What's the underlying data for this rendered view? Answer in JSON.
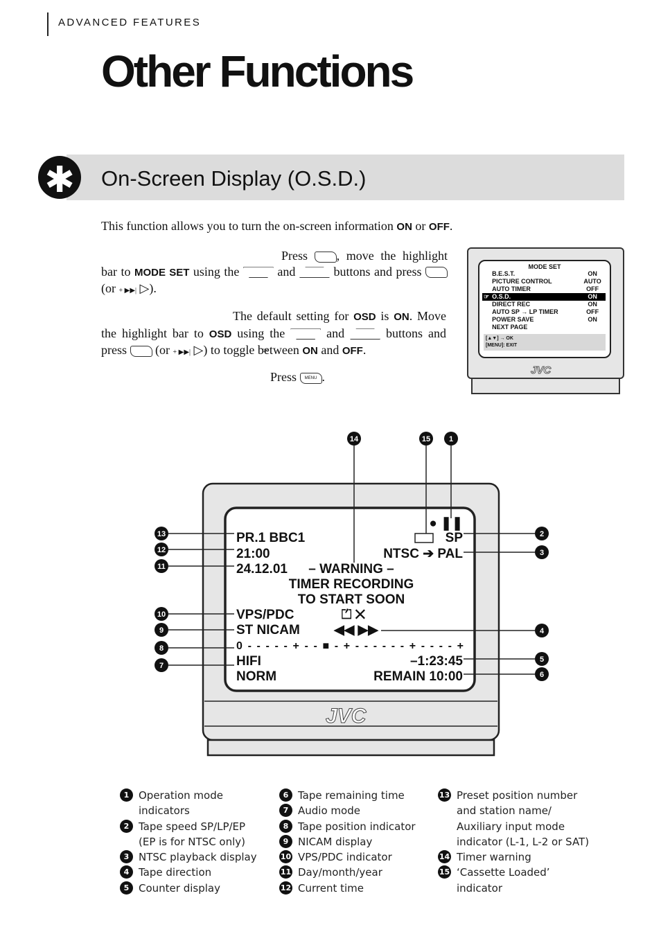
{
  "header": {
    "section": "ADVANCED FEATURES",
    "title": "Other Functions"
  },
  "osd_section": {
    "title": "On-Screen Display (O.S.D.)",
    "intro": [
      "This function allows you to turn the on-screen information ",
      "ON",
      " or ",
      "OFF",
      "."
    ],
    "step1": {
      "a": "Press ",
      "b": ", move the highlight bar to ",
      "c": "MODE SET",
      "d": " using the ",
      "e": " and ",
      "f": " buttons and press ",
      "g": " (or ",
      "h": " ▷)."
    },
    "step2": {
      "a": "The default setting for ",
      "b": "OSD",
      "c": " is ",
      "d": "ON",
      ". Move": "",
      "e": ". Move the highlight bar to ",
      "f": "OSD",
      "g": " using the ",
      "h": " and ",
      "i": " buttons and press ",
      "j": " (or ",
      "k": " ▷) to toggle between ",
      "l": "ON",
      "m": " and ",
      "n": "OFF",
      "o": "."
    },
    "step3": {
      "a": "Press ",
      "b": "."
    },
    "keys": {
      "menu": "MENU",
      "ok": "OK",
      "up": "▲",
      "down": "▼",
      "plus": "+ ▶▶|"
    }
  },
  "mode_set_menu": {
    "title": "MODE SET",
    "items": [
      {
        "label": "B.E.S.T.",
        "value": "ON"
      },
      {
        "label": "PICTURE CONTROL",
        "value": "AUTO"
      },
      {
        "label": "AUTO TIMER",
        "value": "OFF"
      },
      {
        "label": "O.S.D.",
        "value": "ON",
        "highlighted": true
      },
      {
        "label": "DIRECT REC",
        "value": "ON"
      },
      {
        "label": "AUTO SP → LP TIMER",
        "value": "OFF"
      },
      {
        "label": "POWER SAVE",
        "value": "ON"
      },
      {
        "label": "NEXT PAGE",
        "value": ""
      }
    ],
    "footer1": "[▲▼] → OK",
    "footer2": "[MENU]: EXIT",
    "brand": "JVC"
  },
  "osd_screen": {
    "preset": "PR.1 BBC1",
    "time": "21:00",
    "date": "24.12.01",
    "warning": [
      "– WARNING –",
      "TIMER RECORDING",
      "TO START SOON"
    ],
    "vps": "VPS/PDC",
    "nicam": "ST NICAM",
    "tape_pos": "0 - - - - - + - - ■ - + - - - - - - + - - - - +",
    "audio1": "HIFI",
    "audio2": "NORM",
    "op_mode": "● ❚❚",
    "speed": "SP",
    "ntsc": "NTSC ➔ PAL",
    "direction": "◀◀ ▶▶",
    "timer_icons": "⏍ ✕",
    "counter": "–1:23:45",
    "remain": "REMAIN   10:00",
    "brand": "JVC"
  },
  "callouts": {
    "left": [
      "13",
      "12",
      "11",
      "10",
      "9",
      "8",
      "7"
    ],
    "right": [
      "2",
      "3",
      "4",
      "5",
      "6"
    ],
    "top": [
      "14",
      "15",
      "1"
    ]
  },
  "legend": [
    [
      {
        "n": "1",
        "lines": [
          "Operation mode",
          "indicators"
        ]
      },
      {
        "n": "2",
        "lines": [
          "Tape speed SP/LP/EP",
          "(EP is for NTSC only)"
        ]
      },
      {
        "n": "3",
        "lines": [
          "NTSC playback display"
        ]
      },
      {
        "n": "4",
        "lines": [
          "Tape direction"
        ]
      },
      {
        "n": "5",
        "lines": [
          "Counter display"
        ]
      }
    ],
    [
      {
        "n": "6",
        "lines": [
          "Tape remaining time"
        ]
      },
      {
        "n": "7",
        "lines": [
          "Audio mode"
        ]
      },
      {
        "n": "8",
        "lines": [
          "Tape position indicator"
        ]
      },
      {
        "n": "9",
        "lines": [
          "NICAM display"
        ]
      },
      {
        "n": "10",
        "lines": [
          "VPS/PDC indicator"
        ]
      },
      {
        "n": "11",
        "lines": [
          "Day/month/year"
        ]
      },
      {
        "n": "12",
        "lines": [
          "Current time"
        ]
      }
    ],
    [
      {
        "n": "13",
        "lines": [
          "Preset position number",
          "and station name/",
          "Auxiliary input mode",
          "indicator (L-1, L-2 or SAT)"
        ]
      },
      {
        "n": "14",
        "lines": [
          "Timer warning"
        ]
      },
      {
        "n": "15",
        "lines": [
          "‘Cassette Loaded’",
          "indicator"
        ]
      }
    ]
  ]
}
